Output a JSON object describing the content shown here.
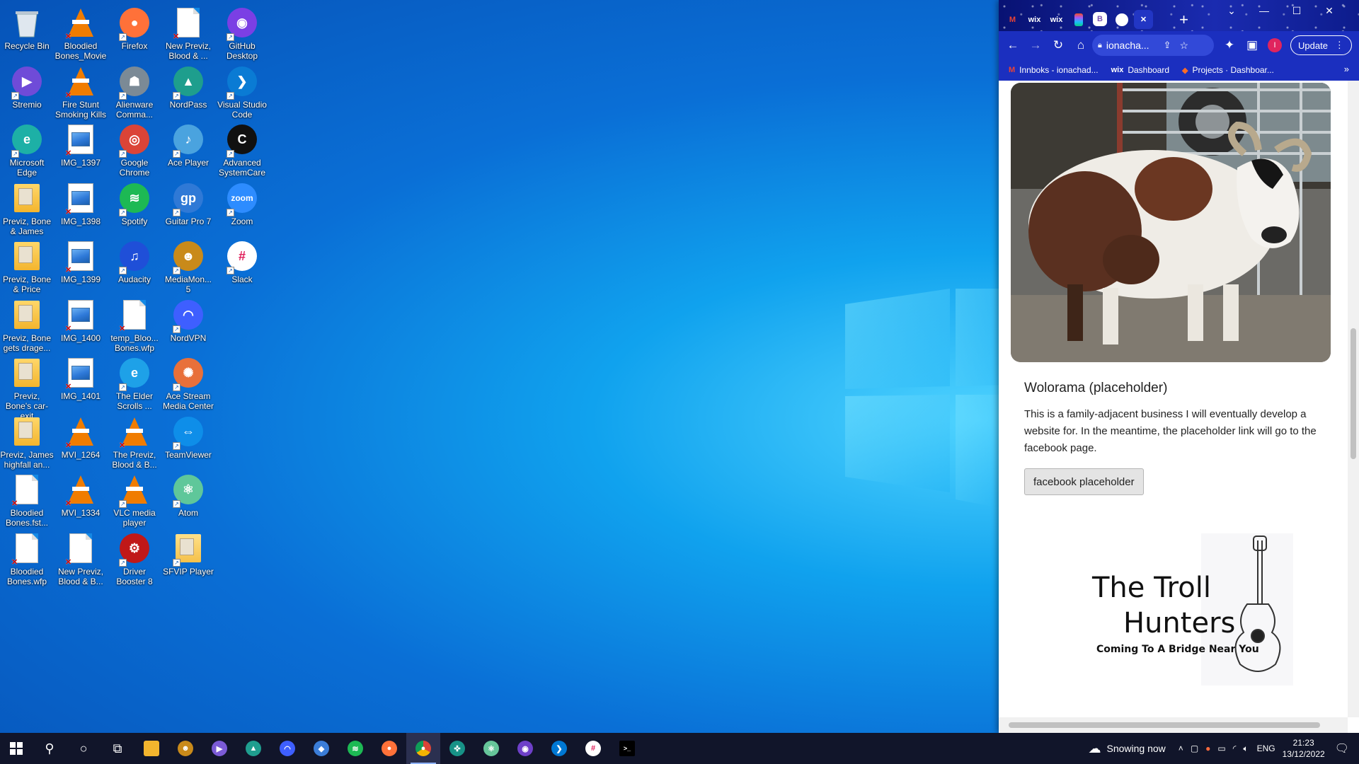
{
  "desktop": {
    "icons": [
      {
        "label": "Recycle Bin",
        "icon": "recycle-bin-icon",
        "col": 0,
        "row": 0
      },
      {
        "label": "Bloodied Bones_Movie",
        "icon": "vlc-file-icon",
        "col": 1,
        "row": 0
      },
      {
        "label": "Firefox",
        "icon": "firefox-icon",
        "col": 2,
        "row": 0
      },
      {
        "label": "New Previz, Blood & ...",
        "icon": "blank-file-icon",
        "col": 3,
        "row": 0
      },
      {
        "label": "GitHub Desktop",
        "icon": "github-desktop-icon",
        "col": 4,
        "row": 0
      },
      {
        "label": "Stremio",
        "icon": "stremio-icon",
        "col": 0,
        "row": 1
      },
      {
        "label": "Fire Stunt Smoking Kills",
        "icon": "vlc-file-icon",
        "col": 1,
        "row": 1
      },
      {
        "label": "Alienware Comma...",
        "icon": "alienware-icon",
        "col": 2,
        "row": 1
      },
      {
        "label": "NordPass",
        "icon": "nordpass-icon",
        "col": 3,
        "row": 1
      },
      {
        "label": "Visual Studio Code",
        "icon": "vscode-icon",
        "col": 4,
        "row": 1
      },
      {
        "label": "Microsoft Edge",
        "icon": "edge-icon",
        "col": 0,
        "row": 2
      },
      {
        "label": "IMG_1397",
        "icon": "image-file-icon",
        "col": 1,
        "row": 2
      },
      {
        "label": "Google Chrome",
        "icon": "chrome-icon",
        "col": 2,
        "row": 2
      },
      {
        "label": "Ace Player",
        "icon": "ace-player-icon",
        "col": 3,
        "row": 2
      },
      {
        "label": "Advanced SystemCare",
        "icon": "advanced-systemcare-icon",
        "col": 4,
        "row": 2
      },
      {
        "label": "Previz, Bone & James",
        "icon": "zip-folder-icon",
        "col": 0,
        "row": 3
      },
      {
        "label": "IMG_1398",
        "icon": "image-file-icon",
        "col": 1,
        "row": 3
      },
      {
        "label": "Spotify",
        "icon": "spotify-icon",
        "col": 2,
        "row": 3
      },
      {
        "label": "Guitar Pro 7",
        "icon": "guitar-pro-icon",
        "col": 3,
        "row": 3
      },
      {
        "label": "Zoom",
        "icon": "zoom-icon",
        "col": 4,
        "row": 3
      },
      {
        "label": "Previz, Bone & Price",
        "icon": "zip-folder-icon",
        "col": 0,
        "row": 4
      },
      {
        "label": "IMG_1399",
        "icon": "image-file-icon",
        "col": 1,
        "row": 4
      },
      {
        "label": "Audacity",
        "icon": "audacity-icon",
        "col": 2,
        "row": 4
      },
      {
        "label": "MediaMon... 5",
        "icon": "mediamonkey-icon",
        "col": 3,
        "row": 4
      },
      {
        "label": "Slack",
        "icon": "slack-icon",
        "col": 4,
        "row": 4
      },
      {
        "label": "Previz, Bone gets drage...",
        "icon": "zip-folder-icon",
        "col": 0,
        "row": 5
      },
      {
        "label": "IMG_1400",
        "icon": "image-file-icon",
        "col": 1,
        "row": 5
      },
      {
        "label": "temp_Bloo... Bones.wfp",
        "icon": "blank-file-icon",
        "col": 2,
        "row": 5
      },
      {
        "label": "NordVPN",
        "icon": "nordvpn-icon",
        "col": 3,
        "row": 5
      },
      {
        "label": "Previz, Bone's car-exit",
        "icon": "zip-folder-icon",
        "col": 0,
        "row": 6
      },
      {
        "label": "IMG_1401",
        "icon": "image-file-icon",
        "col": 1,
        "row": 6
      },
      {
        "label": "The Elder Scrolls ...",
        "icon": "internet-explorer-icon",
        "col": 2,
        "row": 6
      },
      {
        "label": "Ace Stream Media Center",
        "icon": "ace-stream-icon",
        "col": 3,
        "row": 6
      },
      {
        "label": "Previz, James highfall an...",
        "icon": "zip-folder-icon",
        "col": 0,
        "row": 7
      },
      {
        "label": "MVI_1264",
        "icon": "vlc-file-icon",
        "col": 1,
        "row": 7
      },
      {
        "label": "The Previz, Blood & B...",
        "icon": "vlc-file-icon",
        "col": 2,
        "row": 7
      },
      {
        "label": "TeamViewer",
        "icon": "teamviewer-icon",
        "col": 3,
        "row": 7
      },
      {
        "label": "Bloodied Bones.fst...",
        "icon": "blank-file-icon",
        "col": 0,
        "row": 8
      },
      {
        "label": "MVI_1334",
        "icon": "vlc-file-icon",
        "col": 1,
        "row": 8
      },
      {
        "label": "VLC media player",
        "icon": "vlc-icon",
        "col": 2,
        "row": 8
      },
      {
        "label": "Atom",
        "icon": "atom-icon",
        "col": 3,
        "row": 8
      },
      {
        "label": "Bloodied Bones.wfp",
        "icon": "blank-file-icon",
        "col": 0,
        "row": 9
      },
      {
        "label": "New Previz, Blood & B...",
        "icon": "blank-file-icon",
        "col": 1,
        "row": 9
      },
      {
        "label": "Driver Booster 8",
        "icon": "driver-booster-icon",
        "col": 2,
        "row": 9
      },
      {
        "label": "SFVIP Player",
        "icon": "folder-icon",
        "col": 3,
        "row": 9
      }
    ]
  },
  "browser": {
    "tabs": [
      {
        "icon": "gmail-icon",
        "text": "M"
      },
      {
        "icon": "wix-icon",
        "text": "wix"
      },
      {
        "icon": "wix-icon",
        "text": "wix"
      },
      {
        "icon": "figma-icon",
        "text": ""
      },
      {
        "icon": "bootstrap-icon",
        "text": "B"
      },
      {
        "icon": "github-icon",
        "text": ""
      },
      {
        "icon": "close-icon",
        "text": "✕"
      }
    ],
    "address": "ionacha...",
    "update_label": "Update",
    "bookmarks": [
      {
        "icon": "gmail-icon",
        "label": "Innboks - ionachad..."
      },
      {
        "icon": "wix-icon",
        "label": "Dashboard"
      },
      {
        "icon": "gitlab-icon",
        "label": "Projects · Dashboar..."
      }
    ],
    "page": {
      "card_title": "Wolorama (placeholder)",
      "card_text": "This is a family-adjacent business I will eventually develop a website for. In the meantime, the placeholder link will go to the facebook page.",
      "button_label": "facebook placeholder",
      "logo_line1": "The Troll",
      "logo_line2": "Hunters",
      "logo_tagline": "Coming To A Bridge Near You"
    }
  },
  "taskbar": {
    "weather": "Snowing now",
    "language": "ENG",
    "time": "21:23",
    "date": "13/12/2022"
  }
}
